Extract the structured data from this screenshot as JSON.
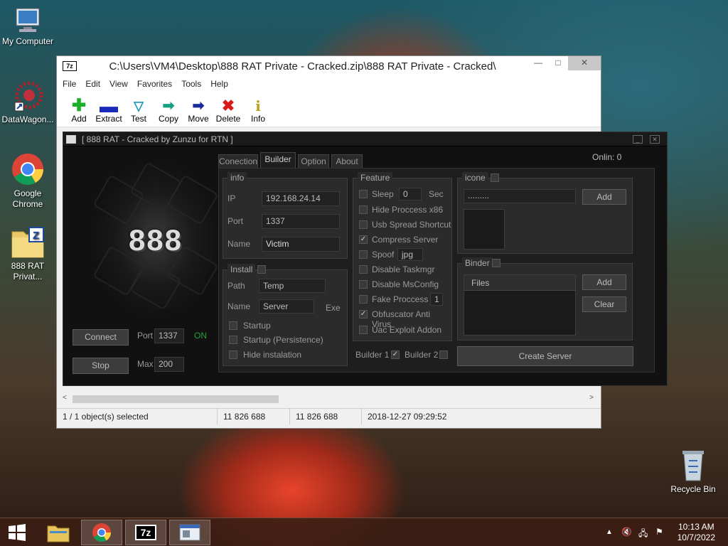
{
  "desktop": {
    "icons": [
      {
        "label": "My Computer",
        "icon": "computer-icon"
      },
      {
        "label": "DataWagon...",
        "icon": "shortcut-icon"
      },
      {
        "label": "Google Chrome",
        "icon": "chrome-icon"
      },
      {
        "label": "888 RAT Privat...",
        "icon": "zip-archive-icon"
      },
      {
        "label": "Recycle Bin",
        "icon": "recycle-bin-icon"
      }
    ]
  },
  "zip": {
    "title": "C:\\Users\\VM4\\Desktop\\888 RAT Private - Cracked.zip\\888 RAT Private - Cracked\\",
    "logo": "7z",
    "menu": [
      "File",
      "Edit",
      "View",
      "Favorites",
      "Tools",
      "Help"
    ],
    "toolbar": [
      "Add",
      "Extract",
      "Test",
      "Copy",
      "Move",
      "Delete",
      "Info"
    ],
    "status": {
      "selected": "1 / 1 object(s) selected",
      "size": "11 826 688",
      "packed": "11 826 688",
      "modified": "2018-12-27 09:29:52"
    }
  },
  "rat": {
    "title": "[  888 RAT - Cracked by Zunzu for RTN ]",
    "logo_text": "888",
    "online": "Onlin:  0",
    "tabs": [
      "Conection",
      "Builder",
      "Option",
      "About"
    ],
    "connect_label": "Connect",
    "stop_label": "Stop",
    "port_label": "Port",
    "port_value": "1337",
    "on_label": "ON",
    "max_label": "Max",
    "max_value": "200",
    "info": {
      "title": "info",
      "ip_label": "IP",
      "ip": "192.168.24.14",
      "port_label": "Port",
      "port": "1337",
      "name_label": "Name",
      "name": "Victim"
    },
    "install": {
      "title": "Install",
      "path_label": "Path",
      "path": "Temp",
      "name_label": "Name",
      "name": "Server",
      "ext": "Exe",
      "startup": "Startup",
      "persistence": "Startup (Persistence)",
      "hide": "Hide instalation"
    },
    "feature": {
      "title": "Feature",
      "sleep": "Sleep",
      "sleep_value": "0",
      "sec": "Sec",
      "hide_process": "Hide Proccess x86",
      "usb": "Usb Spread Shortcut",
      "compress": "Compress Server",
      "spoof": "Spoof",
      "spoof_value": "jpg",
      "taskmgr": "Disable Taskmgr",
      "msconfig": "Disable MsConfig",
      "fake": "Fake Proccess",
      "fake_value": "1",
      "obfuscator": "Obfuscator Anti Virus",
      "uac": "Uac Exploit Addon"
    },
    "builder1": "Builder 1",
    "builder2": "Builder 2",
    "icone": {
      "title": "icone",
      "value": ".........",
      "add": "Add"
    },
    "binder": {
      "title": "Binder",
      "files_header": "Files",
      "add": "Add",
      "clear": "Clear"
    },
    "create_label": "Create Server"
  },
  "taskbar": {
    "time": "10:13 AM",
    "date": "10/7/2022"
  }
}
